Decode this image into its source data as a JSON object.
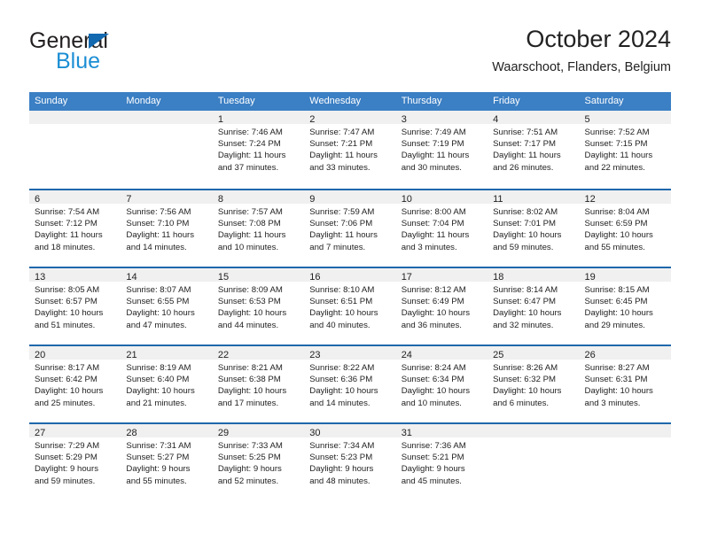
{
  "brand": {
    "name_part1": "General",
    "name_part2": "Blue",
    "logo_icon": "blue-triangle-logo"
  },
  "header": {
    "title": "October 2024",
    "subtitle": "Waarschoot, Flanders, Belgium"
  },
  "colors": {
    "header_band": "#3b7fc4",
    "week_separator": "#1f68ab",
    "daynum_band": "#f0f0f0",
    "brand_dark": "#231f20",
    "brand_blue": "#1c8ed4"
  },
  "weekdays": [
    "Sunday",
    "Monday",
    "Tuesday",
    "Wednesday",
    "Thursday",
    "Friday",
    "Saturday"
  ],
  "weeks": [
    [
      {
        "day": "",
        "lines": []
      },
      {
        "day": "",
        "lines": []
      },
      {
        "day": "1",
        "lines": [
          "Sunrise: 7:46 AM",
          "Sunset: 7:24 PM",
          "Daylight: 11 hours",
          "and 37 minutes."
        ]
      },
      {
        "day": "2",
        "lines": [
          "Sunrise: 7:47 AM",
          "Sunset: 7:21 PM",
          "Daylight: 11 hours",
          "and 33 minutes."
        ]
      },
      {
        "day": "3",
        "lines": [
          "Sunrise: 7:49 AM",
          "Sunset: 7:19 PM",
          "Daylight: 11 hours",
          "and 30 minutes."
        ]
      },
      {
        "day": "4",
        "lines": [
          "Sunrise: 7:51 AM",
          "Sunset: 7:17 PM",
          "Daylight: 11 hours",
          "and 26 minutes."
        ]
      },
      {
        "day": "5",
        "lines": [
          "Sunrise: 7:52 AM",
          "Sunset: 7:15 PM",
          "Daylight: 11 hours",
          "and 22 minutes."
        ]
      }
    ],
    [
      {
        "day": "6",
        "lines": [
          "Sunrise: 7:54 AM",
          "Sunset: 7:12 PM",
          "Daylight: 11 hours",
          "and 18 minutes."
        ]
      },
      {
        "day": "7",
        "lines": [
          "Sunrise: 7:56 AM",
          "Sunset: 7:10 PM",
          "Daylight: 11 hours",
          "and 14 minutes."
        ]
      },
      {
        "day": "8",
        "lines": [
          "Sunrise: 7:57 AM",
          "Sunset: 7:08 PM",
          "Daylight: 11 hours",
          "and 10 minutes."
        ]
      },
      {
        "day": "9",
        "lines": [
          "Sunrise: 7:59 AM",
          "Sunset: 7:06 PM",
          "Daylight: 11 hours",
          "and 7 minutes."
        ]
      },
      {
        "day": "10",
        "lines": [
          "Sunrise: 8:00 AM",
          "Sunset: 7:04 PM",
          "Daylight: 11 hours",
          "and 3 minutes."
        ]
      },
      {
        "day": "11",
        "lines": [
          "Sunrise: 8:02 AM",
          "Sunset: 7:01 PM",
          "Daylight: 10 hours",
          "and 59 minutes."
        ]
      },
      {
        "day": "12",
        "lines": [
          "Sunrise: 8:04 AM",
          "Sunset: 6:59 PM",
          "Daylight: 10 hours",
          "and 55 minutes."
        ]
      }
    ],
    [
      {
        "day": "13",
        "lines": [
          "Sunrise: 8:05 AM",
          "Sunset: 6:57 PM",
          "Daylight: 10 hours",
          "and 51 minutes."
        ]
      },
      {
        "day": "14",
        "lines": [
          "Sunrise: 8:07 AM",
          "Sunset: 6:55 PM",
          "Daylight: 10 hours",
          "and 47 minutes."
        ]
      },
      {
        "day": "15",
        "lines": [
          "Sunrise: 8:09 AM",
          "Sunset: 6:53 PM",
          "Daylight: 10 hours",
          "and 44 minutes."
        ]
      },
      {
        "day": "16",
        "lines": [
          "Sunrise: 8:10 AM",
          "Sunset: 6:51 PM",
          "Daylight: 10 hours",
          "and 40 minutes."
        ]
      },
      {
        "day": "17",
        "lines": [
          "Sunrise: 8:12 AM",
          "Sunset: 6:49 PM",
          "Daylight: 10 hours",
          "and 36 minutes."
        ]
      },
      {
        "day": "18",
        "lines": [
          "Sunrise: 8:14 AM",
          "Sunset: 6:47 PM",
          "Daylight: 10 hours",
          "and 32 minutes."
        ]
      },
      {
        "day": "19",
        "lines": [
          "Sunrise: 8:15 AM",
          "Sunset: 6:45 PM",
          "Daylight: 10 hours",
          "and 29 minutes."
        ]
      }
    ],
    [
      {
        "day": "20",
        "lines": [
          "Sunrise: 8:17 AM",
          "Sunset: 6:42 PM",
          "Daylight: 10 hours",
          "and 25 minutes."
        ]
      },
      {
        "day": "21",
        "lines": [
          "Sunrise: 8:19 AM",
          "Sunset: 6:40 PM",
          "Daylight: 10 hours",
          "and 21 minutes."
        ]
      },
      {
        "day": "22",
        "lines": [
          "Sunrise: 8:21 AM",
          "Sunset: 6:38 PM",
          "Daylight: 10 hours",
          "and 17 minutes."
        ]
      },
      {
        "day": "23",
        "lines": [
          "Sunrise: 8:22 AM",
          "Sunset: 6:36 PM",
          "Daylight: 10 hours",
          "and 14 minutes."
        ]
      },
      {
        "day": "24",
        "lines": [
          "Sunrise: 8:24 AM",
          "Sunset: 6:34 PM",
          "Daylight: 10 hours",
          "and 10 minutes."
        ]
      },
      {
        "day": "25",
        "lines": [
          "Sunrise: 8:26 AM",
          "Sunset: 6:32 PM",
          "Daylight: 10 hours",
          "and 6 minutes."
        ]
      },
      {
        "day": "26",
        "lines": [
          "Sunrise: 8:27 AM",
          "Sunset: 6:31 PM",
          "Daylight: 10 hours",
          "and 3 minutes."
        ]
      }
    ],
    [
      {
        "day": "27",
        "lines": [
          "Sunrise: 7:29 AM",
          "Sunset: 5:29 PM",
          "Daylight: 9 hours",
          "and 59 minutes."
        ]
      },
      {
        "day": "28",
        "lines": [
          "Sunrise: 7:31 AM",
          "Sunset: 5:27 PM",
          "Daylight: 9 hours",
          "and 55 minutes."
        ]
      },
      {
        "day": "29",
        "lines": [
          "Sunrise: 7:33 AM",
          "Sunset: 5:25 PM",
          "Daylight: 9 hours",
          "and 52 minutes."
        ]
      },
      {
        "day": "30",
        "lines": [
          "Sunrise: 7:34 AM",
          "Sunset: 5:23 PM",
          "Daylight: 9 hours",
          "and 48 minutes."
        ]
      },
      {
        "day": "31",
        "lines": [
          "Sunrise: 7:36 AM",
          "Sunset: 5:21 PM",
          "Daylight: 9 hours",
          "and 45 minutes."
        ]
      },
      {
        "day": "",
        "lines": []
      },
      {
        "day": "",
        "lines": []
      }
    ]
  ]
}
